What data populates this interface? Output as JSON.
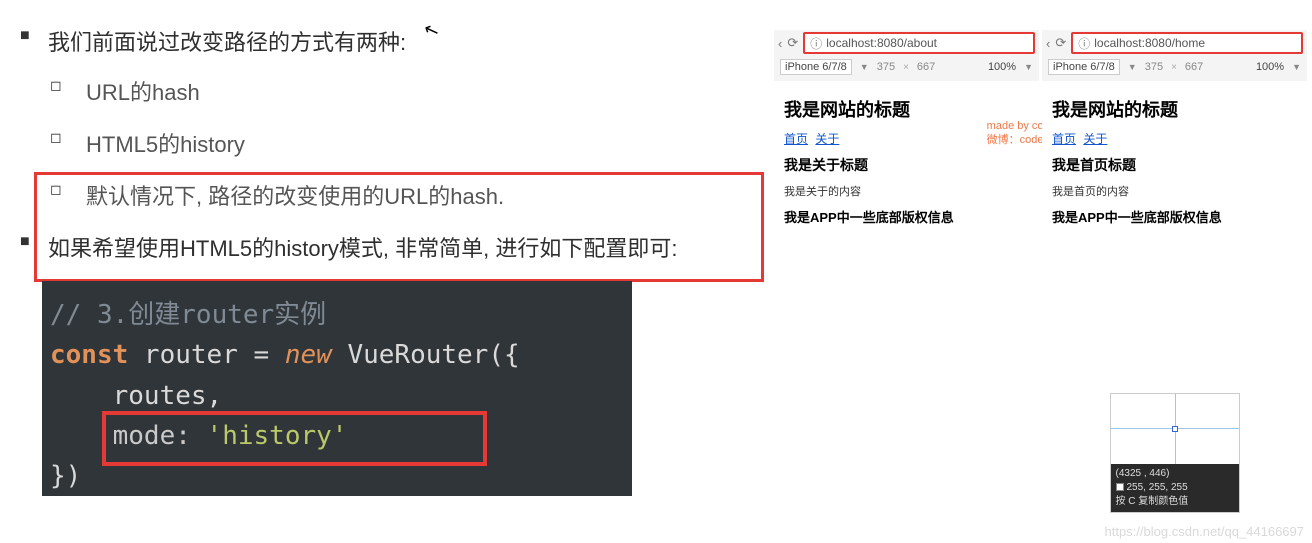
{
  "left": {
    "bullet1": "我们前面说过改变路径的方式有两种:",
    "sub1": "URL的hash",
    "sub2": "HTML5的history",
    "sub3": "默认情况下, 路径的改变使用的URL的hash.",
    "bullet2": "如果希望使用HTML5的history模式, 非常简单, 进行如下配置即可:"
  },
  "code": {
    "l1_comment": "// 3.创建router实例",
    "l2_kw_const": "const",
    "l2_id": " router = ",
    "l2_kw_new": "new",
    "l2_cls": " VueRouter({",
    "l3": "    routes,",
    "l4_prop": "    mode: ",
    "l4_str": "'history'",
    "l5": "})"
  },
  "previews": [
    {
      "url": "localhost:8080/about",
      "device": "iPhone 6/7/8",
      "dim_w": "375",
      "dim_h": "667",
      "zoom": "100%",
      "title": "我是网站的标题",
      "link_home": "首页",
      "link_about": "关于",
      "section_title": "我是关于标题",
      "section_content": "我是关于的内容",
      "footer": "我是APP中一些底部版权信息"
    },
    {
      "url": "localhost:8080/home",
      "device": "iPhone 6/7/8",
      "dim_w": "375",
      "dim_h": "667",
      "zoom": "100%",
      "title": "我是网站的标题",
      "link_home": "首页",
      "link_about": "关于",
      "section_title": "我是首页标题",
      "section_content": "我是首页的内容",
      "footer": "我是APP中一些底部版权信息"
    }
  ],
  "made_by": {
    "line1": "made by coderwhy",
    "line2": "微博：coderwhy"
  },
  "dev_popover": {
    "coords": "(4325  ,  446)",
    "rgb": "255, 255, 255",
    "hint": "按 C 复制颜色值"
  },
  "blog_mark": "https://blog.csdn.net/qq_44166697"
}
